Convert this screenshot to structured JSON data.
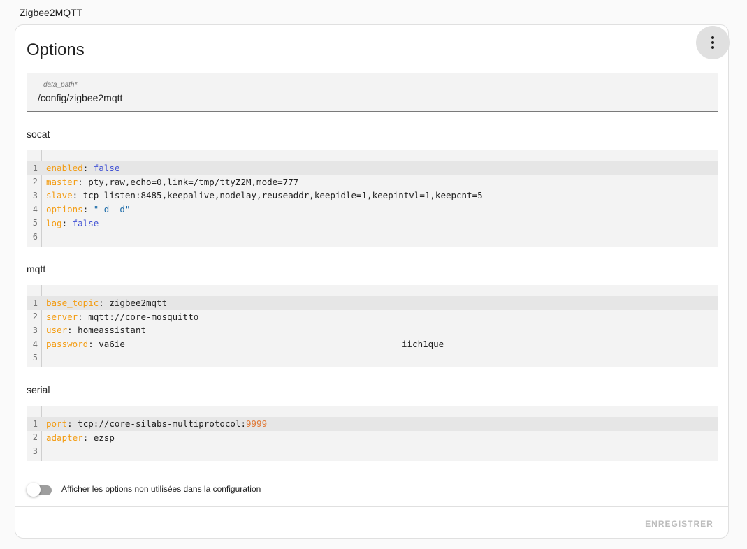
{
  "app": {
    "title": "Zigbee2MQTT"
  },
  "card": {
    "title": "Options",
    "menu_icon": "dots-vertical-icon",
    "data_path": {
      "label": "data_path*",
      "value": "/config/zigbee2mqtt"
    },
    "sections": [
      {
        "label": "socat",
        "lines": [
          {
            "num": "1",
            "key": "enabled",
            "value": "false",
            "value_type": "bool"
          },
          {
            "num": "2",
            "key": "master",
            "value": "pty,raw,echo=0,link=/tmp/ttyZ2M,mode=777",
            "value_type": "plain"
          },
          {
            "num": "3",
            "key": "slave",
            "value": "tcp-listen:8485,keepalive,nodelay,reuseaddr,keepidle=1,keepintvl=1,keepcnt=5",
            "value_type": "plain"
          },
          {
            "num": "4",
            "key": "options",
            "value": "\"-d -d\"",
            "value_type": "string"
          },
          {
            "num": "5",
            "key": "log",
            "value": "false",
            "value_type": "bool"
          },
          {
            "num": "6",
            "key": "",
            "value": "",
            "value_type": "plain"
          }
        ]
      },
      {
        "label": "mqtt",
        "lines": [
          {
            "num": "1",
            "key": "base_topic",
            "value": "zigbee2mqtt",
            "value_type": "plain"
          },
          {
            "num": "2",
            "key": "server",
            "value": "mqtt://core-mosquitto",
            "value_type": "plain"
          },
          {
            "num": "3",
            "key": "user",
            "value": "homeassistant",
            "value_type": "plain"
          },
          {
            "num": "4",
            "key": "password",
            "value": "va6ie",
            "value_extra": "iich1que",
            "value_type": "plain"
          },
          {
            "num": "5",
            "key": "",
            "value": "",
            "value_type": "plain"
          }
        ]
      },
      {
        "label": "serial",
        "lines": [
          {
            "num": "1",
            "key": "port",
            "value": "tcp://core-silabs-multiprotocol:",
            "value_num": "9999",
            "value_type": "plain"
          },
          {
            "num": "2",
            "key": "adapter",
            "value": "ezsp",
            "value_type": "plain"
          },
          {
            "num": "3",
            "key": "",
            "value": "",
            "value_type": "plain"
          }
        ]
      }
    ],
    "toggle": {
      "label": "Afficher les options non utilisées dans la configuration",
      "checked": false
    },
    "save_label": "ENREGISTRER"
  },
  "colors": {
    "key": "#f39c12",
    "bool": "#4051d4",
    "string": "#1a6aa8",
    "number": "#e07a39",
    "disabled_text": "#bdbdbd"
  }
}
